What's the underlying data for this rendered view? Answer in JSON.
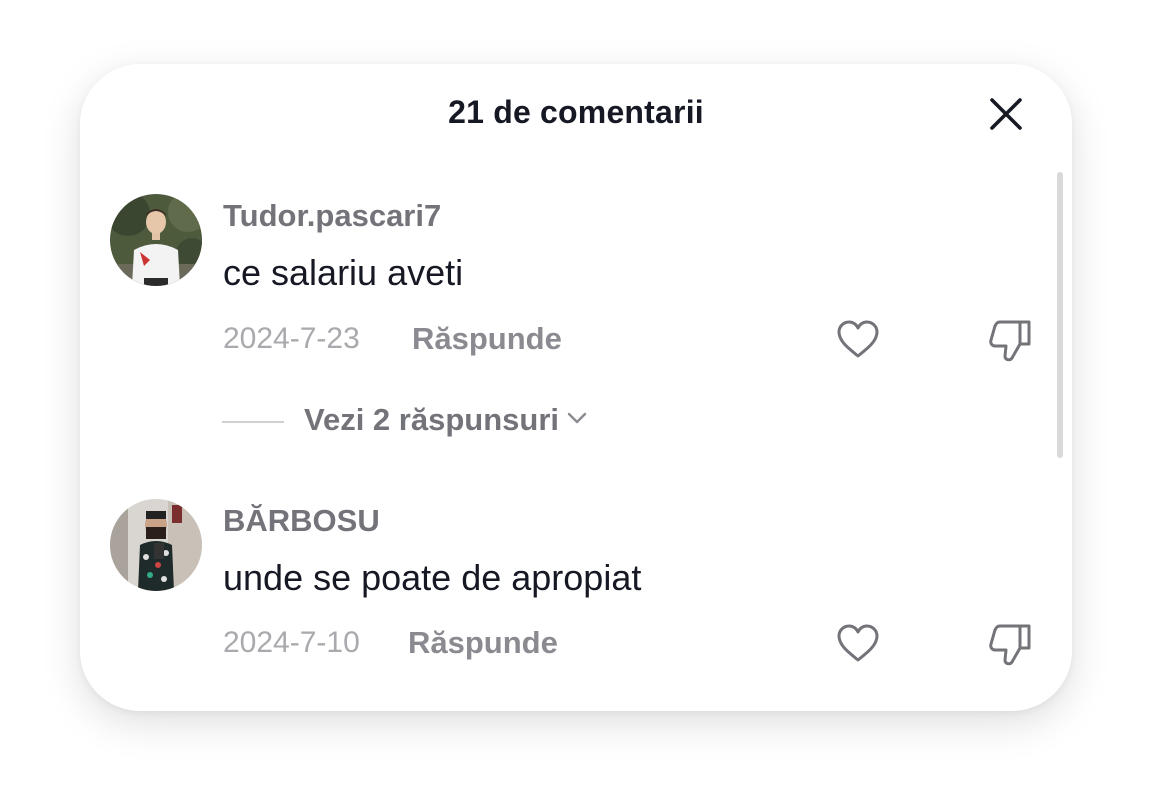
{
  "header": {
    "title": "21 de comentarii",
    "close_icon": "close-icon"
  },
  "comments": [
    {
      "username": "Tudor.pascari7",
      "text": "ce salariu aveti",
      "date": "2024-7-23",
      "reply_label": "Răspunde",
      "view_replies_label": "Vezi 2 răspunsuri"
    },
    {
      "username": "BĂRBOSU",
      "text": "unde se poate de apropiat",
      "date": "2024-7-10",
      "reply_label": "Răspunde"
    }
  ],
  "icons": {
    "like": "heart-outline-icon",
    "dislike": "thumbs-down-outline-icon",
    "expand": "chevron-down-icon"
  },
  "colors": {
    "primary_text": "#161823",
    "secondary_text": "#73737a",
    "muted_text": "#a9a9ae"
  }
}
